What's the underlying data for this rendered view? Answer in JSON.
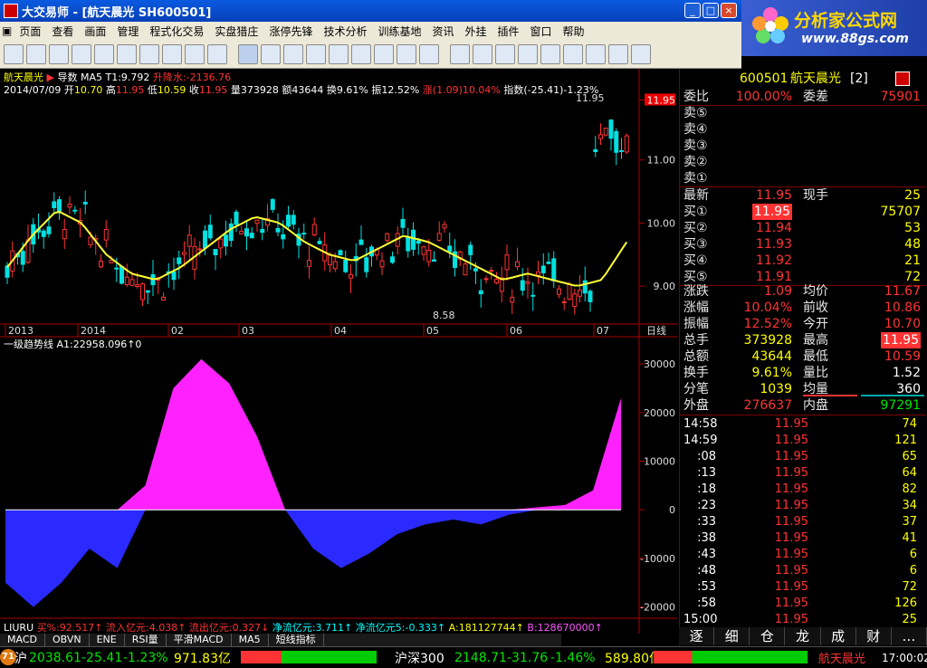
{
  "window": {
    "title": "大交易师 - [航天晨光 SH600501]"
  },
  "logo": {
    "title": "分析家公式网",
    "url": "www.88gs.com"
  },
  "menu": [
    "页面",
    "查看",
    "画面",
    "管理",
    "程式化交易",
    "实盘猎庄",
    "涨停先锋",
    "技术分析",
    "训练基地",
    "资讯",
    "外挂",
    "插件",
    "窗口",
    "帮助"
  ],
  "chart": {
    "name": "航天晨光",
    "indicator": "导数",
    "ma": "MA5",
    "t1": "T1:9.792",
    "updown": "升降水:-2136.76",
    "date": "2014/07/09",
    "open_l": "开",
    "open": "10.70",
    "high_l": "高",
    "high": "11.95",
    "low_l": "低",
    "low": "10.59",
    "close_l": "收",
    "close": "11.95",
    "vol": "量373928",
    "amt": "额43644",
    "turn": "换9.61%",
    "amp": "振12.52%",
    "chg": "涨(1.09)10.04%",
    "index": "指数(-25.41)-1.23%",
    "price_ticks": [
      "11.95",
      "11.00",
      "10.00",
      "9.00"
    ],
    "high_label": "11.95",
    "low_label": "8.58",
    "x_labels": [
      "2013",
      "2014",
      "02",
      "03",
      "04",
      "05",
      "06",
      "07"
    ],
    "period": "日线",
    "sub_title": "一级趋势线",
    "sub_val": "A1:22958.096↑0",
    "sub_ticks": [
      "30000",
      "20000",
      "10000",
      "0",
      "-10000",
      "-20000"
    ],
    "bottom_line": [
      "LIURU",
      "买%:92.517↑",
      "流入亿元:4.038↑",
      "流出亿元:0.327↓",
      "净流亿元:3.711↑",
      "净流亿元5:-0.333↑",
      "A:181127744↑",
      "B:128670000↑"
    ]
  },
  "chart_data": {
    "type": "line",
    "series": [
      {
        "name": "MA5",
        "values": [
          9.3,
          9.8,
          10.2,
          10.0,
          9.5,
          9.2,
          9.1,
          9.3,
          9.6,
          9.9,
          10.1,
          10.0,
          9.7,
          9.5,
          9.4,
          9.6,
          9.8,
          9.7,
          9.5,
          9.3,
          9.1,
          9.2,
          9.1,
          9.0,
          9.1,
          9.7
        ]
      },
      {
        "name": "一级趋势线",
        "values": [
          -15000,
          -20000,
          -15000,
          -8000,
          -12000,
          5000,
          25000,
          31000,
          26000,
          15000,
          0,
          -8000,
          -12000,
          -9000,
          -5000,
          -3000,
          -2000,
          -3000,
          -1000,
          500,
          1000,
          4000,
          22958
        ]
      }
    ]
  },
  "quote": {
    "code": "600501",
    "name": "航天晨光",
    "suffix": "[2]",
    "weibi_l": "委比",
    "weibi": "100.00%",
    "weicha_l": "委差",
    "weicha": "75901",
    "sells": [
      {
        "l": "卖⑤",
        "p": "",
        "v": ""
      },
      {
        "l": "卖④",
        "p": "",
        "v": ""
      },
      {
        "l": "卖③",
        "p": "",
        "v": ""
      },
      {
        "l": "卖②",
        "p": "",
        "v": ""
      },
      {
        "l": "卖①",
        "p": "",
        "v": ""
      }
    ],
    "last_l": "最新",
    "last": "11.95",
    "cur_l": "现手",
    "cur": "25",
    "buys": [
      {
        "l": "买①",
        "p": "11.95",
        "v": "75707"
      },
      {
        "l": "买②",
        "p": "11.94",
        "v": "53"
      },
      {
        "l": "买③",
        "p": "11.93",
        "v": "48"
      },
      {
        "l": "买④",
        "p": "11.92",
        "v": "21"
      },
      {
        "l": "买⑤",
        "p": "11.91",
        "v": "72"
      }
    ],
    "stats": [
      {
        "l": "涨跌",
        "v": "1.09",
        "l2": "均价",
        "v2": "11.67"
      },
      {
        "l": "涨幅",
        "v": "10.04%",
        "l2": "前收",
        "v2": "10.86"
      },
      {
        "l": "振幅",
        "v": "12.52%",
        "l2": "今开",
        "v2": "10.70"
      },
      {
        "l": "总手",
        "v": "373928",
        "l2": "最高",
        "v2": "11.95"
      },
      {
        "l": "总额",
        "v": "43644",
        "l2": "最低",
        "v2": "10.59"
      },
      {
        "l": "换手",
        "v": "9.61%",
        "l2": "量比",
        "v2": "1.52"
      },
      {
        "l": "分笔",
        "v": "1039",
        "l2": "均量",
        "v2": "360"
      }
    ],
    "outer_l": "外盘",
    "outer": "276637",
    "inner_l": "内盘",
    "inner": "97291"
  },
  "ticks": [
    {
      "t": "14:58",
      "p": "11.95",
      "v": "74"
    },
    {
      "t": "14:59",
      "p": "11.95",
      "v": "121"
    },
    {
      "t": ":08",
      "p": "11.95",
      "v": "65"
    },
    {
      "t": ":13",
      "p": "11.95",
      "v": "64"
    },
    {
      "t": ":18",
      "p": "11.95",
      "v": "82"
    },
    {
      "t": ":23",
      "p": "11.95",
      "v": "34"
    },
    {
      "t": ":33",
      "p": "11.95",
      "v": "37"
    },
    {
      "t": ":38",
      "p": "11.95",
      "v": "41"
    },
    {
      "t": ":43",
      "p": "11.95",
      "v": "6"
    },
    {
      "t": ":48",
      "p": "11.95",
      "v": "6"
    },
    {
      "t": ":53",
      "p": "11.95",
      "v": "72"
    },
    {
      "t": ":58",
      "p": "11.95",
      "v": "126"
    },
    {
      "t": "15:00",
      "p": "11.95",
      "v": "25"
    }
  ],
  "right_tabs": [
    "逐",
    "细",
    "仓",
    "龙",
    "成",
    "财",
    "…"
  ],
  "bottom_tabs": [
    "MACD",
    "OBVN",
    "ENE",
    "RSI量",
    "平滑MACD",
    "MA5",
    "短线指标"
  ],
  "status": {
    "sh": "沪",
    "sh_idx": "2038.61",
    "sh_chg": "-25.41",
    "sh_pct": "-1.23%",
    "sh_amt": "971.83亿",
    "hs_l": "沪深300",
    "hs_idx": "2148.71",
    "hs_chg": "-31.76",
    "hs_pct": "-1.46%",
    "hs_amt": "589.80亿",
    "stock": "航天晨光",
    "time": "17:00:02",
    "badge": "71"
  }
}
